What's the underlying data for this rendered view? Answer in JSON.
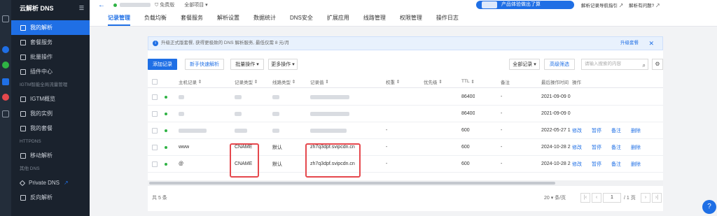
{
  "sidebar": {
    "brand": "云解析 DNS",
    "items": [
      {
        "label": "我的解析",
        "icon": "list-icon"
      },
      {
        "label": "套餐服务",
        "icon": "package-icon"
      },
      {
        "label": "批量操作",
        "icon": "batch-icon"
      },
      {
        "label": "插件中心",
        "icon": "plugin-icon"
      }
    ],
    "section_gtm": "IGTM智能全局流量管理",
    "gtm_items": [
      {
        "label": "IGTM概览",
        "icon": "grid-icon"
      },
      {
        "label": "我的实例",
        "icon": "instance-icon"
      },
      {
        "label": "我的套餐",
        "icon": "package-icon"
      }
    ],
    "section_httpdns": "HTTPDNS",
    "httpdns_items": [
      {
        "label": "移动解析",
        "icon": "mobile-icon"
      }
    ],
    "section_other": "其他 DNS",
    "other_items": [
      {
        "label": "Private DNS",
        "icon": "diamond-icon"
      },
      {
        "label": "反向解析",
        "icon": "reverse-icon"
      }
    ]
  },
  "topbar": {
    "edition": "免费版",
    "project": "全部项目",
    "promo": "产品体验做出了算",
    "link1": "解析记录导航指引",
    "link2": "解析有问题?"
  },
  "tabs": [
    "记录管理",
    "负载均衡",
    "套餐服务",
    "解析设置",
    "数据统计",
    "DNS安全",
    "扩展应用",
    "线路管理",
    "权限管理",
    "操作日志"
  ],
  "banner": {
    "text": "升级正式版套餐, 获得更极致的 DNS 解析服务, 最低仅需 8 元/月",
    "upgrade": "升级套餐"
  },
  "toolbar": {
    "add": "添加记录",
    "quick": "新手快速解析",
    "batch": "批量操作",
    "more": "更多操作",
    "all_records": "全部记录",
    "advanced": "高级筛选",
    "search_placeholder": "请输入搜索的内容"
  },
  "table": {
    "headers": [
      "主机记录",
      "记录类型",
      "线路类型",
      "记录值",
      "权重",
      "优先级",
      "TTL",
      "备注",
      "最后操作时间",
      "操作"
    ],
    "rows": [
      {
        "host": "",
        "type": "",
        "line": "",
        "value": "",
        "weight": "",
        "priority": "",
        "ttl": "86400",
        "note": "-",
        "time": "2021-09-09 0",
        "ops": []
      },
      {
        "host": "",
        "type": "",
        "line": "",
        "value": "",
        "weight": "",
        "priority": "",
        "ttl": "86400",
        "note": "-",
        "time": "2021-09-09 0",
        "ops": []
      },
      {
        "host": "",
        "type": "",
        "line": "",
        "value": "",
        "weight": "-",
        "priority": "",
        "ttl": "600",
        "note": "-",
        "time": "2022-05-27 1",
        "ops": [
          "修改",
          "暂停",
          "备注",
          "删除"
        ]
      },
      {
        "host": "www",
        "type": "CNAME",
        "line": "默认",
        "value": "zh7q3dpf.svipcdn.cn",
        "weight": "-",
        "priority": "",
        "ttl": "600",
        "note": "-",
        "time": "2024-10-28 2",
        "ops": [
          "修改",
          "暂停",
          "备注",
          "删除"
        ]
      },
      {
        "host": "@",
        "type": "CNAME",
        "line": "默认",
        "value": "zh7q3dpf.svipcdn.cn",
        "weight": "-",
        "priority": "",
        "ttl": "600",
        "note": "-",
        "time": "2024-10-28 2",
        "ops": [
          "修改",
          "暂停",
          "备注",
          "删除"
        ]
      }
    ]
  },
  "footer": {
    "total": "共 5 条",
    "page_size": "20",
    "page": "1",
    "total_pages": "/ 1 页"
  },
  "colors": {
    "accent": "#1f6fe5",
    "highlight": "#e5484d",
    "status_on": "#2fb344"
  }
}
